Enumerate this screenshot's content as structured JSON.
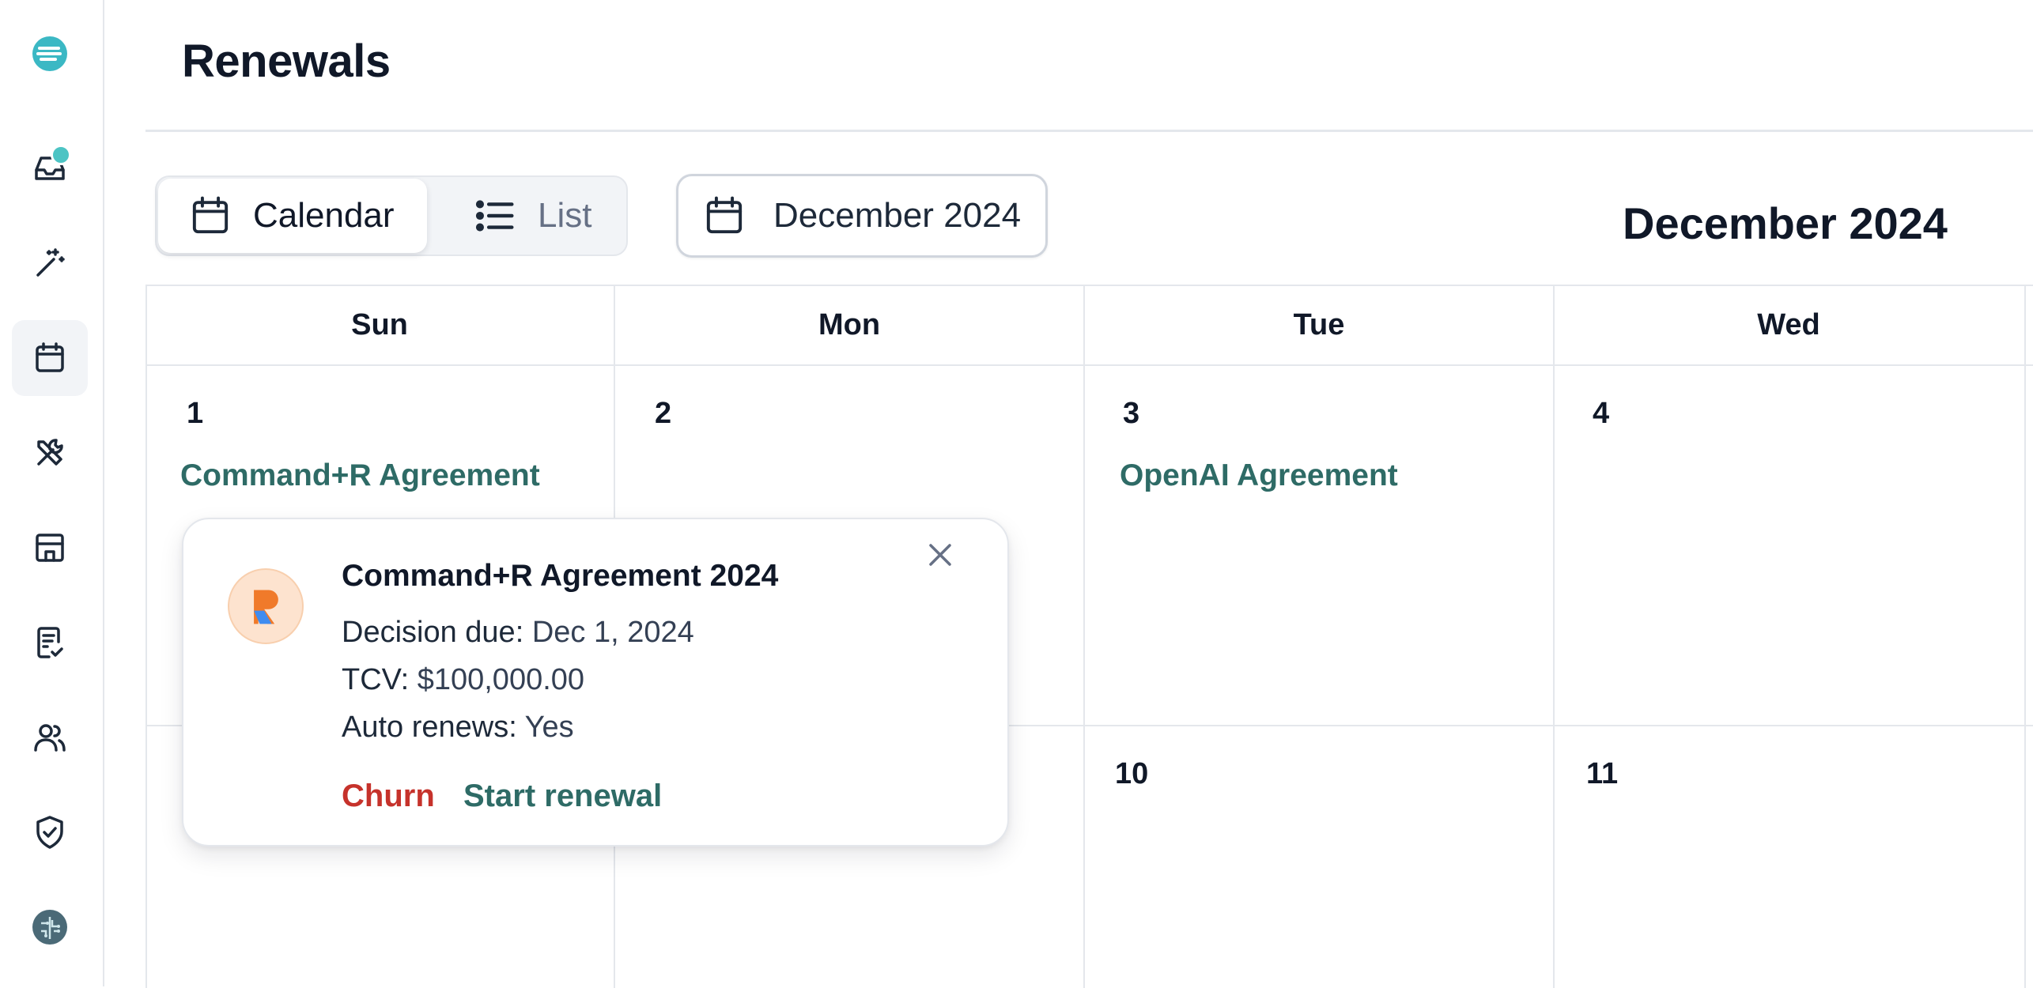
{
  "app": {
    "brand_color": "#3bb8c4",
    "accent_color": "#2e6b66",
    "danger_color": "#c6322b"
  },
  "sidebar": {
    "items": [
      {
        "icon": "logo-icon"
      },
      {
        "icon": "inbox-icon",
        "has_badge": true
      },
      {
        "icon": "magic-wand-icon"
      },
      {
        "icon": "calendar-icon",
        "active": true
      },
      {
        "icon": "tools-icon"
      },
      {
        "icon": "store-icon"
      },
      {
        "icon": "document-check-icon"
      },
      {
        "icon": "users-icon"
      },
      {
        "icon": "shield-check-icon"
      },
      {
        "icon": "ai-brain-icon"
      }
    ]
  },
  "header": {
    "title": "Renewals"
  },
  "toolbar": {
    "view_calendar_label": "Calendar",
    "view_list_label": "List",
    "active_view": "Calendar",
    "month_picker_value": "December 2024"
  },
  "calendar": {
    "heading": "December 2024",
    "weekdays": [
      "Sun",
      "Mon",
      "Tue",
      "Wed"
    ],
    "days": [
      {
        "number": "1",
        "event": "Command+R Agreement"
      },
      {
        "number": "2",
        "event": ""
      },
      {
        "number": "3",
        "event": "OpenAI Agreement"
      },
      {
        "number": "4",
        "event": ""
      },
      {
        "number": "10",
        "event": ""
      },
      {
        "number": "11",
        "event": ""
      }
    ]
  },
  "popover": {
    "title": "Command+R Agreement 2024",
    "decision_label": "Decision due:",
    "decision_value": "Dec 1, 2024",
    "tcv_label": "TCV:",
    "tcv_value": "$100,000.00",
    "auto_renew_label": "Auto renews:",
    "auto_renew_value": "Yes",
    "churn_label": "Churn",
    "start_renewal_label": "Start renewal"
  }
}
